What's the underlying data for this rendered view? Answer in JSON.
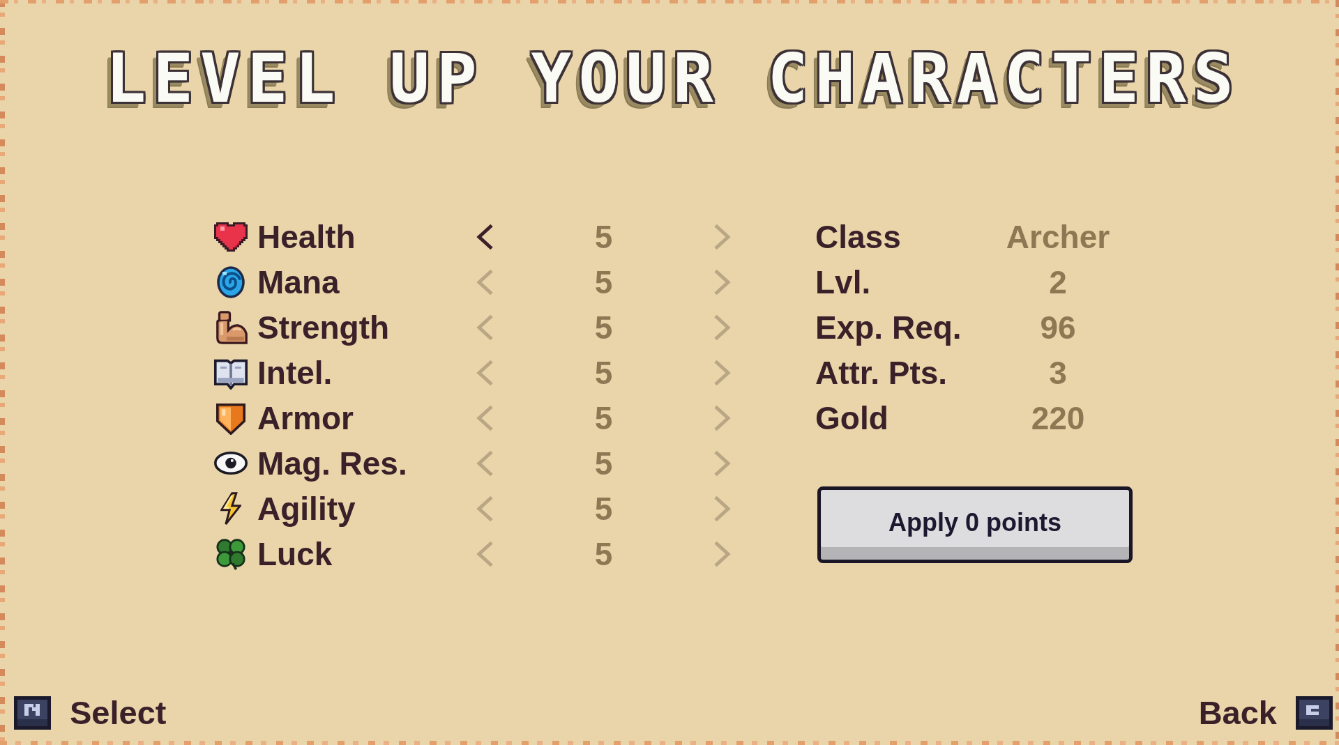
{
  "title": "LEVEL UP YOUR CHARACTERS",
  "attributes": [
    {
      "name": "Health",
      "value": "5",
      "decrease": {
        "selected": true
      },
      "increase": {
        "selected": false
      }
    },
    {
      "name": "Mana",
      "value": "5",
      "decrease": {
        "selected": false
      },
      "increase": {
        "selected": false
      }
    },
    {
      "name": "Strength",
      "value": "5",
      "decrease": {
        "selected": false
      },
      "increase": {
        "selected": false
      }
    },
    {
      "name": "Intel.",
      "value": "5",
      "decrease": {
        "selected": false
      },
      "increase": {
        "selected": false
      }
    },
    {
      "name": "Armor",
      "value": "5",
      "decrease": {
        "selected": false
      },
      "increase": {
        "selected": false
      }
    },
    {
      "name": "Mag. Res.",
      "value": "5",
      "decrease": {
        "selected": false
      },
      "increase": {
        "selected": false
      }
    },
    {
      "name": "Agility",
      "value": "5",
      "decrease": {
        "selected": false
      },
      "increase": {
        "selected": false
      }
    },
    {
      "name": "Luck",
      "value": "5",
      "decrease": {
        "selected": false
      },
      "increase": {
        "selected": false
      }
    }
  ],
  "info": [
    {
      "label": "Class",
      "value": "Archer"
    },
    {
      "label": "Lvl.",
      "value": "2"
    },
    {
      "label": "Exp. Req.",
      "value": "96"
    },
    {
      "label": "Attr. Pts.",
      "value": "3"
    },
    {
      "label": "Gold",
      "value": "220"
    }
  ],
  "apply_button": {
    "label": "Apply 0 points"
  },
  "footer": {
    "left_hint": "Select",
    "right_hint": "Back"
  }
}
